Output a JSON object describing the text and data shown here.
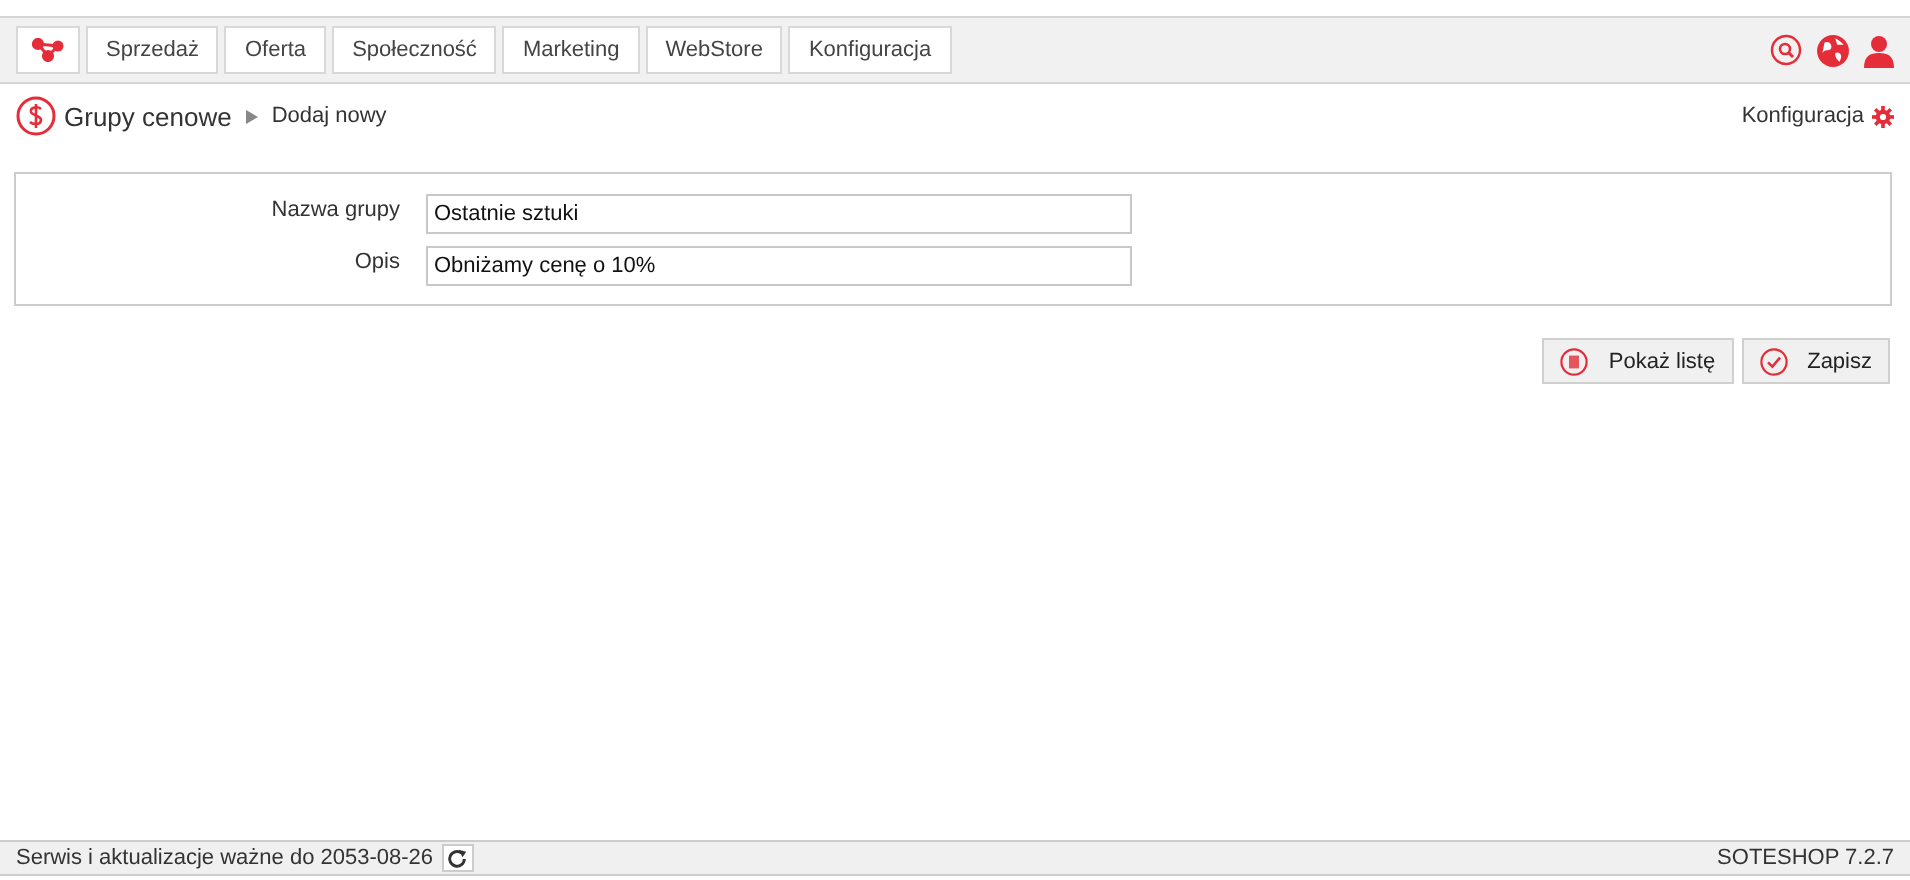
{
  "nav": {
    "tabs": [
      "Sprzedaż",
      "Oferta",
      "Społeczność",
      "Marketing",
      "WebStore",
      "Konfiguracja"
    ]
  },
  "breadcrumb": {
    "title": "Grupy cenowe",
    "current": "Dodaj nowy",
    "config_link": "Konfiguracja"
  },
  "form": {
    "fields": [
      {
        "label": "Nazwa grupy",
        "value": "Ostatnie sztuki"
      },
      {
        "label": "Opis",
        "value": "Obniżamy cenę o 10%"
      }
    ]
  },
  "buttons": [
    {
      "kind": "list",
      "label": "Pokaż listę"
    },
    {
      "kind": "save",
      "label": "Zapisz"
    }
  ],
  "status_bar": {
    "license": "Serwis i aktualizacje ważne do 2053-08-26",
    "version": "SOTESHOP 7.2.7"
  }
}
